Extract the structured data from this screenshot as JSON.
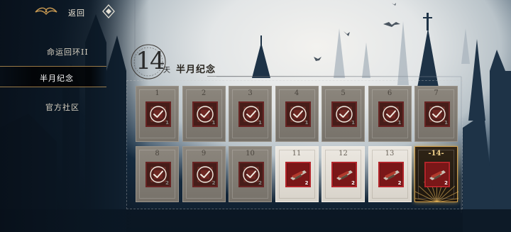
{
  "nav": {
    "back_label": "返回",
    "logo_icon": "wing-crest-icon",
    "menu_icon": "diamond-icon"
  },
  "sidebar": {
    "items": [
      {
        "label": "命运回环II",
        "active": false
      },
      {
        "label": "半月纪念",
        "active": true
      },
      {
        "label": "官方社区",
        "active": false
      }
    ]
  },
  "event": {
    "day_count": "14",
    "day_unit": "天",
    "title": "半月纪念"
  },
  "days": [
    {
      "day": "1",
      "claimed": true,
      "count": "1",
      "item": "red-ticket-icon"
    },
    {
      "day": "2",
      "claimed": true,
      "count": "1",
      "item": "red-ticket-icon"
    },
    {
      "day": "3",
      "claimed": true,
      "count": "1",
      "item": "red-ticket-icon"
    },
    {
      "day": "4",
      "claimed": true,
      "count": "1",
      "item": "red-ticket-icon"
    },
    {
      "day": "5",
      "claimed": true,
      "count": "1",
      "item": "red-ticket-icon"
    },
    {
      "day": "6",
      "claimed": true,
      "count": "1",
      "item": "red-ticket-icon"
    },
    {
      "day": "7",
      "claimed": true,
      "count": "1",
      "item": "red-ticket-icon"
    },
    {
      "day": "8",
      "claimed": true,
      "count": "2",
      "item": "red-ticket-icon"
    },
    {
      "day": "9",
      "claimed": true,
      "count": "2",
      "item": "red-ticket-icon"
    },
    {
      "day": "10",
      "claimed": true,
      "count": "2",
      "item": "red-ticket-icon"
    },
    {
      "day": "11",
      "claimed": false,
      "count": "2",
      "item": "crossbow-icon"
    },
    {
      "day": "12",
      "claimed": false,
      "count": "2",
      "item": "crossbow-icon"
    },
    {
      "day": "13",
      "claimed": false,
      "count": "2",
      "item": "crossbow-icon"
    },
    {
      "day": "14",
      "claimed": false,
      "current": true,
      "count": "2",
      "item": "crossbow-icon"
    }
  ],
  "colors": {
    "accent_gold": "#d2a04b",
    "item_red": "#b3242a",
    "card_gray": "#8c867d",
    "card_light": "#ece8e1"
  }
}
